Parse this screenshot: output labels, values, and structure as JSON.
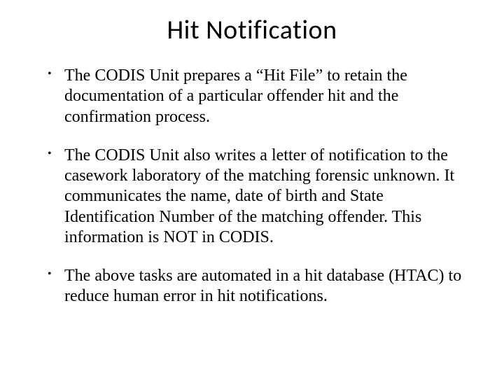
{
  "slide": {
    "title": "Hit Notification",
    "bullets": [
      "The CODIS Unit prepares a “Hit File” to retain the documentation of a particular offender hit and the confirmation process.",
      "The CODIS Unit also writes a letter of notification to the casework laboratory of the matching forensic unknown.  It communicates the name, date of birth and State Identification Number of the matching offender.  This information is NOT in CODIS.",
      "The above tasks are automated in a hit database (HTAC) to reduce human error in hit notifications."
    ]
  }
}
